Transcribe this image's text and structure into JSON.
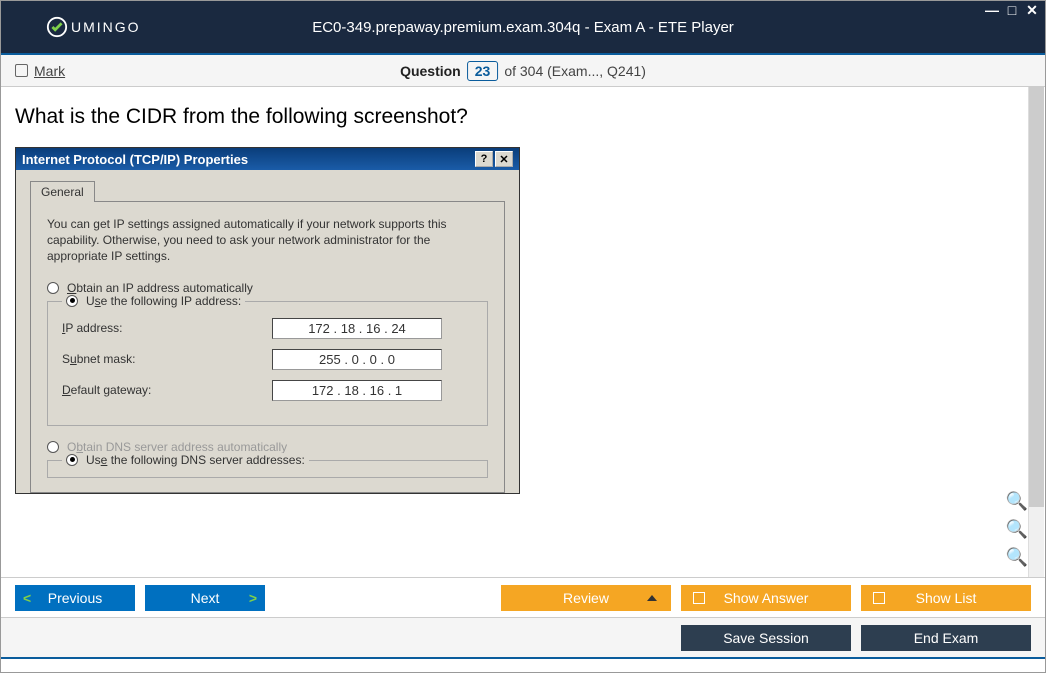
{
  "titlebar": {
    "logo_text": "UMINGO",
    "title": "EC0-349.prepaway.premium.exam.304q - Exam A - ETE Player"
  },
  "qheader": {
    "mark_label": "Mark",
    "question_label": "Question",
    "question_number": "23",
    "of_total": "of 304 (Exam..., Q241)"
  },
  "question": {
    "text": "What is the CIDR from the following screenshot?"
  },
  "tcpip": {
    "title": "Internet Protocol (TCP/IP) Properties",
    "tab": "General",
    "desc": "You can get IP settings assigned automatically if your network supports this capability. Otherwise, you need to ask your network administrator for the appropriate IP settings.",
    "obtain_ip": "Obtain an IP address automatically",
    "use_ip": "Use the following IP address:",
    "ip_label": "IP address:",
    "ip_value": "172 . 18 . 16 . 24",
    "subnet_label": "Subnet mask:",
    "subnet_value": "255 .  0  .  0  .  0",
    "gateway_label": "Default gateway:",
    "gateway_value": "172 . 18 . 16 .  1",
    "obtain_dns": "Obtain DNS server address automatically",
    "use_dns": "Use the following DNS server addresses:"
  },
  "footer": {
    "previous": "Previous",
    "next": "Next",
    "review": "Review",
    "show_answer": "Show Answer",
    "show_list": "Show List",
    "save_session": "Save Session",
    "end_exam": "End Exam"
  }
}
